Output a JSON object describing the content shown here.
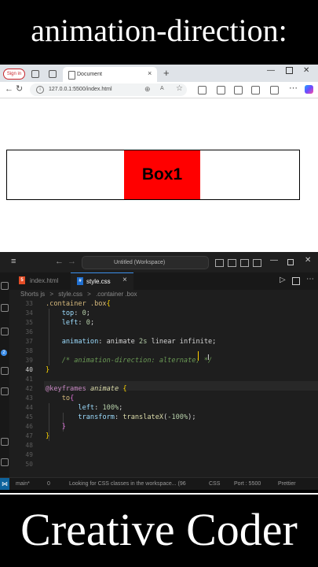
{
  "banner": {
    "top_title": "animation-direction:",
    "bottom_title": "Creative Coder"
  },
  "browser": {
    "signin_label": "Sign in",
    "tab_title": "Document",
    "tab_close": "×",
    "new_tab": "+",
    "url": "127.0.0.1:5500/index.html",
    "page": {
      "box_label": "Box1"
    }
  },
  "vscode": {
    "search_label": "Untitled (Workspace)",
    "tabs": [
      {
        "label": "index.html",
        "icon": "html-file-icon",
        "active": false
      },
      {
        "label": "style.css",
        "icon": "css-file-icon",
        "active": true
      }
    ],
    "breadcrumbs": [
      "Shorts js",
      ">",
      "style.css",
      ">",
      ".container .box"
    ],
    "active_line": 40,
    "line_numbers": [
      33,
      34,
      35,
      36,
      37,
      38,
      39,
      40,
      41,
      42,
      43,
      44,
      45,
      46,
      47,
      48,
      49,
      50
    ],
    "status": {
      "branch": "main*",
      "warnings": "0",
      "message": "Looking for CSS classes in the workspace... (96",
      "language": "CSS",
      "port": "Port : 5500",
      "formatter": "Prettier"
    }
  },
  "colors": {
    "box": "#ff0000",
    "status_remote": "#0e639c",
    "editor_bg": "#1e1e1e"
  }
}
